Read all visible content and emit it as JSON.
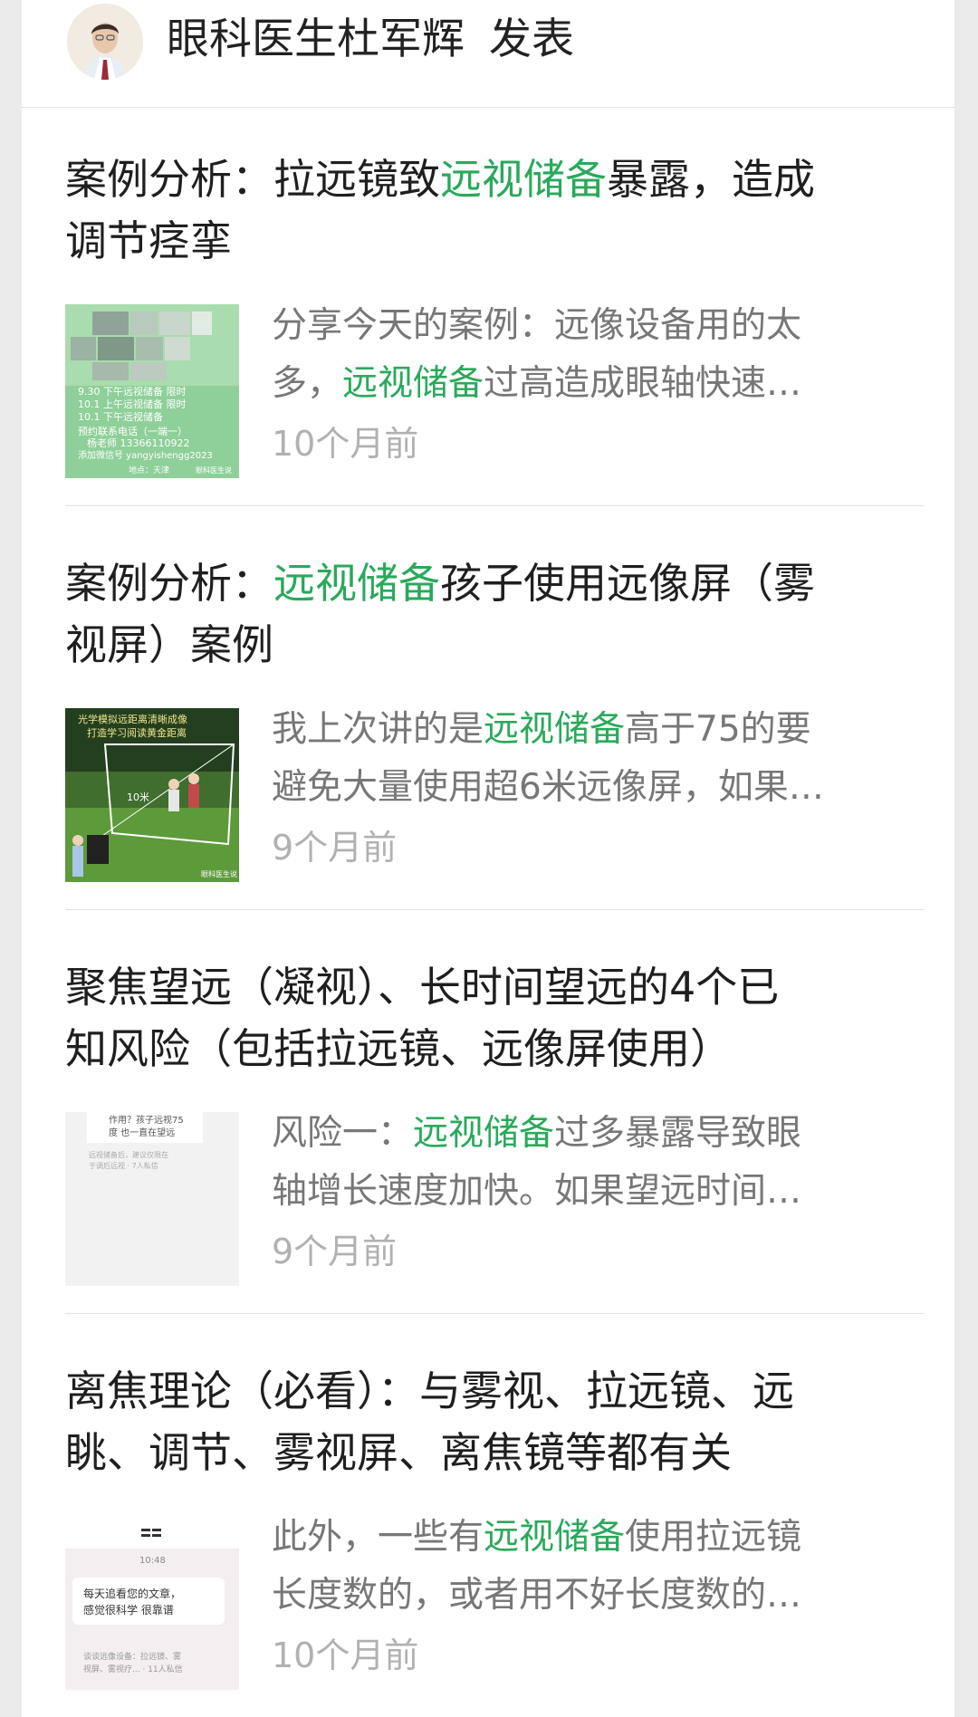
{
  "author_header": {
    "author_name": "眼科医生杜军辉",
    "action": "发表"
  },
  "posts": [
    {
      "title_line1": [
        "案例分析：拉远镜致",
        "远视储备",
        "暴露，造成"
      ],
      "title_line2": "调节痉挛",
      "excerpt_line1": "分享今天的案例：远像设备用的太",
      "excerpt_line2": [
        "多，",
        "远视储备",
        "过高造成眼轴快速…"
      ],
      "time": "10个月前",
      "thumb_text": {
        "line1": "9.30 下午远视储备 限时",
        "line2": "10.1 上午远视储备 限时",
        "line3": "10.1 下午远视储备",
        "line4": "预约联系电话（一端一）",
        "line5": "杨老师 13366110922",
        "line6": "添加微信号 yangyishengg2023",
        "line7": "地点：天津",
        "line8": "眼科医生说"
      }
    },
    {
      "title_line1": [
        "案例分析：",
        "远视储备",
        "孩子使用远像屏（雾"
      ],
      "title_line2": "视屏）案例",
      "excerpt_line1": [
        "我上次讲的是",
        "远视储备",
        "高于75的要"
      ],
      "excerpt_line2": "避免大量使用超6米远像屏，如果…",
      "time": "9个月前",
      "thumb_text": {
        "line1": "光学模拟远距离清晰成像",
        "line2": "打造学习阅读黄金距离",
        "distance": "10米",
        "watermark": "眼科医生说"
      }
    },
    {
      "title_line1": "聚焦望远（凝视）、长时间望远的4个已",
      "title_line2": "知风险（包括拉远镜、远像屏使用）",
      "excerpt_line1": [
        "风险一：",
        "远视储备",
        "过多暴露导致眼"
      ],
      "excerpt_line2": "轴增长速度加快。如果望远时间…",
      "time": "9个月前",
      "thumb_text": {
        "line1": "作用？孩子远视75",
        "line2": "度 也一直在望远",
        "line3": "远视储备后，建议仅限在",
        "line4": "于调后远视 · 7人私信"
      }
    },
    {
      "title_line1": "离焦理论（必看）：与雾视、拉远镜、远",
      "title_line2": "眺、调节、雾视屏、离焦镜等都有关",
      "excerpt_line1": [
        "此外，一些有",
        "远视储备",
        "使用拉远镜"
      ],
      "excerpt_line2": "长度数的，或者用不好长度数的…",
      "time": "10个月前",
      "thumb_text": {
        "clock": "10:48",
        "message_line1": "每天追看您的文章，",
        "message_line2": "感觉很科学 很靠谱",
        "footer_line1": "谈谈远像设备：拉远镜、雾",
        "footer_line2": "视屏、雾视疗... · 11人私信"
      }
    }
  ],
  "colors": {
    "highlight": "#2aa95b",
    "title": "#1f1f1f",
    "excerpt": "#777777",
    "time": "#b1b1b1",
    "background": "#ebebeb"
  }
}
